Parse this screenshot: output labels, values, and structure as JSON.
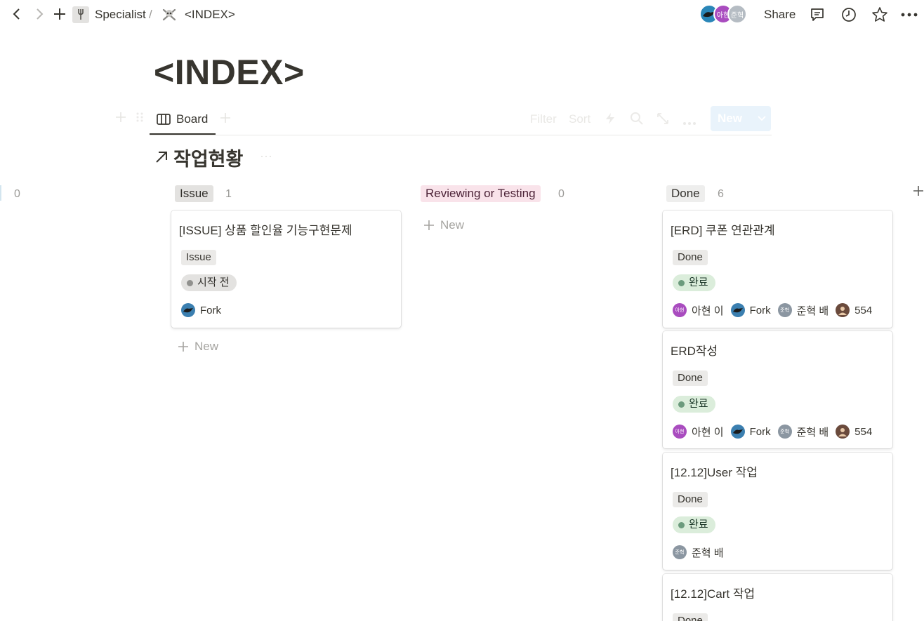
{
  "topbar": {
    "workspace": "Specialist",
    "separator": "/",
    "page": "<INDEX>",
    "avatars": [
      "아현",
      "준혁"
    ],
    "share_label": "Share",
    "icons": [
      "back-icon",
      "forward-icon",
      "plus-icon",
      "fork-icon",
      "skull-icon",
      "comment-icon",
      "clock-icon",
      "star-icon",
      "more-icon"
    ]
  },
  "page_title": "<INDEX>",
  "views": {
    "active_tab": "Board",
    "toolbar": {
      "filter": "Filter",
      "sort": "Sort",
      "new_label": "New"
    }
  },
  "section": {
    "title": "작업현황",
    "icon": "arrow-up-right-icon"
  },
  "board": {
    "hidden_group_count": "0",
    "columns": [
      {
        "name": "Issue",
        "count": "1",
        "tag_bg": "#e3e2e0",
        "tag_fg": "#32302c",
        "cards": [
          {
            "title": "[ISSUE] 상품 할인율 기능구현문제",
            "tag": "Issue",
            "status": "시작 전",
            "status_color": "#91918e",
            "status_bg": "#e3e2e0",
            "people": [
              {
                "name": "Fork",
                "avatar": "fork"
              }
            ]
          }
        ],
        "new_label": "New"
      },
      {
        "name": "Reviewing or Testing",
        "count": "0",
        "tag_bg": "#f9e3ea",
        "tag_fg": "#4c2337",
        "cards": [],
        "new_label": "New"
      },
      {
        "name": "Done",
        "count": "6",
        "tag_bg": "#eeeeed",
        "tag_fg": "#32302c",
        "cards": [
          {
            "title": "[ERD] 쿠폰 연관관계",
            "tag": "Done",
            "status": "완료",
            "status_color": "#6c9b7d",
            "status_bg": "#dbeddb",
            "people": [
              {
                "name": "아현 이",
                "avatar": "아현"
              },
              {
                "name": "Fork",
                "avatar": "fork"
              },
              {
                "name": "준혁 배",
                "avatar": "준혁"
              },
              {
                "name": "554",
                "avatar": "554"
              }
            ]
          },
          {
            "title": "ERD작성",
            "tag": "Done",
            "status": "완료",
            "status_color": "#6c9b7d",
            "status_bg": "#dbeddb",
            "people": [
              {
                "name": "아현 이",
                "avatar": "아현"
              },
              {
                "name": "Fork",
                "avatar": "fork"
              },
              {
                "name": "준혁 배",
                "avatar": "준혁"
              },
              {
                "name": "554",
                "avatar": "554"
              }
            ]
          },
          {
            "title": "[12.12]User 작업",
            "tag": "Done",
            "status": "완료",
            "status_color": "#6c9b7d",
            "status_bg": "#dbeddb",
            "people": [
              {
                "name": "준혁 배",
                "avatar": "준혁"
              }
            ]
          },
          {
            "title": "[12.12]Cart 작업",
            "tag": "Done"
          }
        ]
      }
    ]
  }
}
